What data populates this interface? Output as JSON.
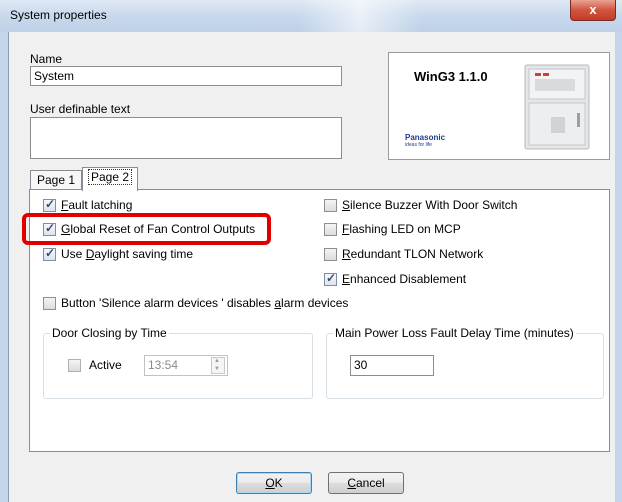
{
  "window": {
    "title": "System properties",
    "close_glyph": "x"
  },
  "name_field": {
    "label": "Name",
    "value": "System"
  },
  "user_text_field": {
    "label": "User definable text",
    "value": ""
  },
  "logo": {
    "product": "WinG3 1.1.0",
    "brand": "Panasonic",
    "tagline": "ideas for life"
  },
  "tabs": [
    {
      "label": "Page 1",
      "selected": false
    },
    {
      "label": "Page 2",
      "selected": true
    }
  ],
  "checkboxes_left": [
    {
      "prefix": "",
      "accel": "F",
      "rest": "ault latching",
      "checked": true
    },
    {
      "prefix": "",
      "accel": "G",
      "rest": "lobal Reset of Fan Control Outputs",
      "checked": true
    },
    {
      "prefix": "Use ",
      "accel": "D",
      "rest": "aylight saving time",
      "checked": true
    }
  ],
  "checkboxes_right": [
    {
      "prefix": "",
      "accel": "S",
      "rest": "ilence Buzzer With Door Switch",
      "checked": false
    },
    {
      "prefix": "",
      "accel": "F",
      "rest": "lashing LED on MCP",
      "checked": false
    },
    {
      "prefix": "",
      "accel": "R",
      "rest": "edundant TLON Network",
      "checked": false
    },
    {
      "prefix": "",
      "accel": "E",
      "rest": "nhanced Disablement",
      "checked": true
    }
  ],
  "silence_option": {
    "prefix": "Button 'Silence alarm devices ' disables ",
    "accel": "a",
    "rest": "larm devices",
    "checked": false
  },
  "door_group": {
    "title": "Door Closing by Time",
    "active_label": "Active",
    "active_checked": false,
    "time_value": "13:54"
  },
  "power_group": {
    "title": "Main Power Loss Fault Delay Time (minutes)",
    "value": "30"
  },
  "buttons": {
    "ok": {
      "accel": "O",
      "rest": "K"
    },
    "cancel": {
      "accel": "C",
      "rest": "ancel"
    }
  },
  "colors": {
    "highlight": "#e00000",
    "titlebar": "#c9d9ec",
    "close": "#c23d28"
  }
}
